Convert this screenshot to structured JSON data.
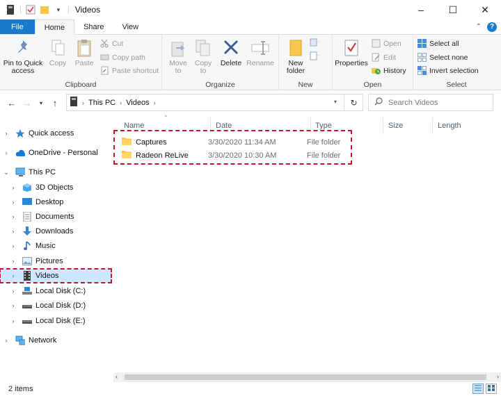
{
  "window": {
    "title": "Videos",
    "minimize": "–",
    "maximize": "☐",
    "close": "✕"
  },
  "tabs": {
    "file": "File",
    "home": "Home",
    "share": "Share",
    "view": "View",
    "collapse": "⌃",
    "help": "?"
  },
  "ribbon": {
    "clipboard": {
      "label": "Clipboard",
      "pin": "Pin to Quick access",
      "copy": "Copy",
      "paste": "Paste",
      "cut": "Cut",
      "copy_path": "Copy path",
      "paste_shortcut": "Paste shortcut"
    },
    "organize": {
      "label": "Organize",
      "move_to": "Move to",
      "copy_to": "Copy to",
      "delete": "Delete",
      "rename": "Rename"
    },
    "new": {
      "label": "New",
      "new_folder": "New folder"
    },
    "open": {
      "label": "Open",
      "properties": "Properties",
      "open": "Open",
      "edit": "Edit",
      "history": "History"
    },
    "select": {
      "label": "Select",
      "select_all": "Select all",
      "select_none": "Select none",
      "invert_selection": "Invert selection"
    }
  },
  "address": {
    "crumbs": [
      "This PC",
      "Videos"
    ],
    "search_placeholder": "Search Videos"
  },
  "nav": {
    "quick_access": "Quick access",
    "onedrive": "OneDrive - Personal",
    "this_pc": "This PC",
    "objects3d": "3D Objects",
    "desktop": "Desktop",
    "documents": "Documents",
    "downloads": "Downloads",
    "music": "Music",
    "pictures": "Pictures",
    "videos": "Videos",
    "disk_c": "Local Disk (C:)",
    "disk_d": "Local Disk (D:)",
    "disk_e": "Local Disk (E:)",
    "network": "Network"
  },
  "columns": {
    "name": "Name",
    "date": "Date",
    "type": "Type",
    "size": "Size",
    "length": "Length"
  },
  "files": [
    {
      "name": "Captures",
      "date": "3/30/2020 11:34 AM",
      "type": "File folder"
    },
    {
      "name": "Radeon ReLive",
      "date": "3/30/2020 10:30 AM",
      "type": "File folder"
    }
  ],
  "status": {
    "count": "2 items"
  },
  "colors": {
    "accent": "#1979ca",
    "highlight": "#c8102e",
    "folder": "#f8c648",
    "selection": "#cce8ff"
  }
}
